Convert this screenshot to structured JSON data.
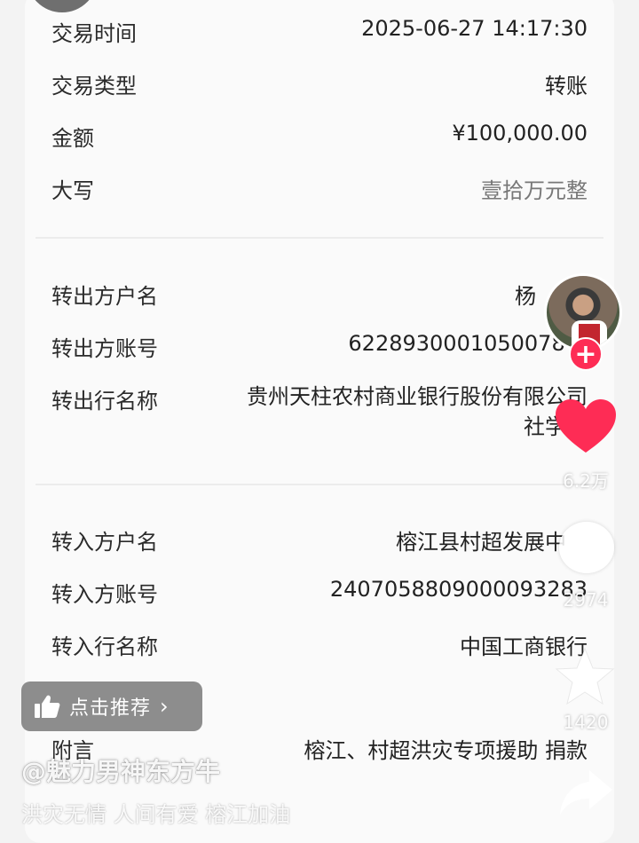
{
  "transaction": {
    "time": {
      "label": "交易时间",
      "value": "2025-06-27 14:17:30"
    },
    "type": {
      "label": "交易类型",
      "value": "转账"
    },
    "amount": {
      "label": "金额",
      "value": "¥100,000.00"
    },
    "amount_words": {
      "label": "大写",
      "value": "壹拾万元整"
    }
  },
  "payer": {
    "name": {
      "label": "转出方户名",
      "value": "杨"
    },
    "account": {
      "label": "转出方账号",
      "value": "62289300010500784"
    },
    "bank": {
      "label": "转出行名称",
      "value": "贵州天柱农村商业银行股份有限公司社学支"
    }
  },
  "payee": {
    "name": {
      "label": "转入方户名",
      "value": "榕江县村超发展中"
    },
    "account": {
      "label": "转入方账号",
      "value": "2407058809000093283"
    },
    "bank": {
      "label": "转入行名称",
      "value": "中国工商银行"
    }
  },
  "remark": {
    "label": "附言",
    "value": "榕江、村超洪灾专项援助 捐款"
  },
  "overlay": {
    "likes": "6.2万",
    "comments": "2974",
    "favorites": "1420",
    "follow_symbol": "+",
    "recommend_label": "点击推荐",
    "recommend_chevron": "›",
    "author": "@魅力男神东方牛",
    "caption": "洪灾无情 人间有爱 榕江加油"
  },
  "icons": {
    "like": "heart-icon",
    "comment": "comment-icon",
    "favorite": "star-icon",
    "share": "share-icon",
    "recommend": "thumbs-up-icon"
  },
  "colors": {
    "like_red": "#fe2c55",
    "card_bg": "#fafafa"
  }
}
